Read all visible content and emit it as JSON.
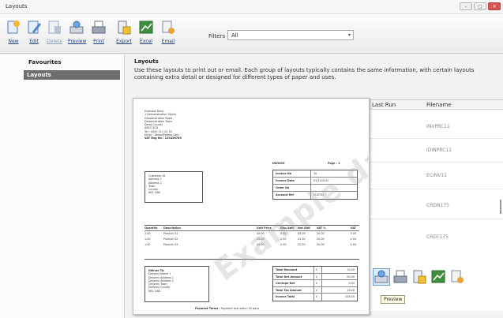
{
  "window": {
    "title": "Layouts"
  },
  "toolbar": {
    "buttons": [
      {
        "label": "New",
        "icon": "new-layout-icon"
      },
      {
        "label": "Edit",
        "icon": "edit-layout-icon"
      },
      {
        "label": "Delete",
        "icon": "delete-layout-icon"
      },
      {
        "label": "Preview",
        "icon": "preview-icon"
      },
      {
        "label": "Print",
        "icon": "print-icon"
      },
      {
        "label": "Export",
        "icon": "export-icon"
      },
      {
        "label": "Excel",
        "icon": "excel-icon"
      },
      {
        "label": "Email",
        "icon": "email-icon"
      }
    ],
    "filters_label": "Filters",
    "filters_value": "All"
  },
  "sidebar": {
    "heading": "Favourites",
    "items": [
      {
        "label": "Layouts",
        "selected": true
      }
    ]
  },
  "main": {
    "title": "Layouts",
    "description": "Use these layouts to print out or email. Each group of layouts typically contains the same information, with certain layouts containing extra detail or designed for different types of paper and uses."
  },
  "grid": {
    "columns": [
      "Last Run",
      "Filename"
    ],
    "rows": [
      "INVPRC11",
      "IDINPRC11",
      "ECINV11",
      "CRDN175",
      "CRDT175"
    ]
  },
  "bottom_icons": [
    "preview-icon",
    "print-icon",
    "export-icon",
    "excel-icon",
    "email-icon"
  ],
  "tooltip": "Preview",
  "preview": {
    "watermark": "Example data",
    "company_lines": [
      "Example Data",
      "1 Demonstration Street",
      "Demonstration Road",
      "Demonstration Town",
      "Demo County",
      "AB12 3CD",
      "Tel : 0000 111 22 33",
      "Email : demo@demo.com",
      "VAT Reg No : 123456789"
    ],
    "customer_lines": [
      "Customer ID",
      "Address 1",
      "Address 2",
      "Town",
      "County",
      "NE1 2AB"
    ],
    "invoice_title": "INVOICE",
    "page_label": "Page : 1",
    "invoice_fields": [
      {
        "k": "Invoice No",
        "v": "10"
      },
      {
        "k": "Invoice Date",
        "v": "01/12/2012"
      },
      {
        "k": "Order No",
        "v": ""
      },
      {
        "k": "Account Ref",
        "v": "CUST01"
      }
    ],
    "line_headers": [
      "Quantity",
      "Description",
      "Unit Price",
      "Disc Amt",
      "Net Amt",
      "VAT %",
      "VAT"
    ],
    "lines": [
      [
        "1.00",
        "Product 01",
        "50.00",
        "0.00",
        "45.00",
        "20.00",
        "9.00"
      ],
      [
        "1.00",
        "Product 02",
        "25.00",
        "2.50",
        "22.50",
        "20.00",
        "4.50"
      ],
      [
        "1.00",
        "Product 03",
        "25.00",
        "2.50",
        "22.50",
        "20.00",
        "4.50"
      ]
    ],
    "delivery_lines": [
      "Deliver To:",
      "Delivery Name 1",
      "Delivery Address 1",
      "Delivery Address 2",
      "Delivery Town",
      "Delivery County",
      "NE1 2AB"
    ],
    "totals": [
      {
        "k": "Total Discount",
        "cur": "£",
        "v": "10.00"
      },
      {
        "k": "Total Net Amount",
        "cur": "£",
        "v": "90.00"
      },
      {
        "k": "Carriage Net",
        "cur": "£",
        "v": "0.00"
      },
      {
        "k": "Total Tax Amount",
        "cur": "£",
        "v": "18.00"
      },
      {
        "k": "Invoice Total",
        "cur": "£",
        "v": "108.00"
      }
    ],
    "terms_label": "Payment Terms :",
    "terms_text": "Payment due within 30 days"
  }
}
